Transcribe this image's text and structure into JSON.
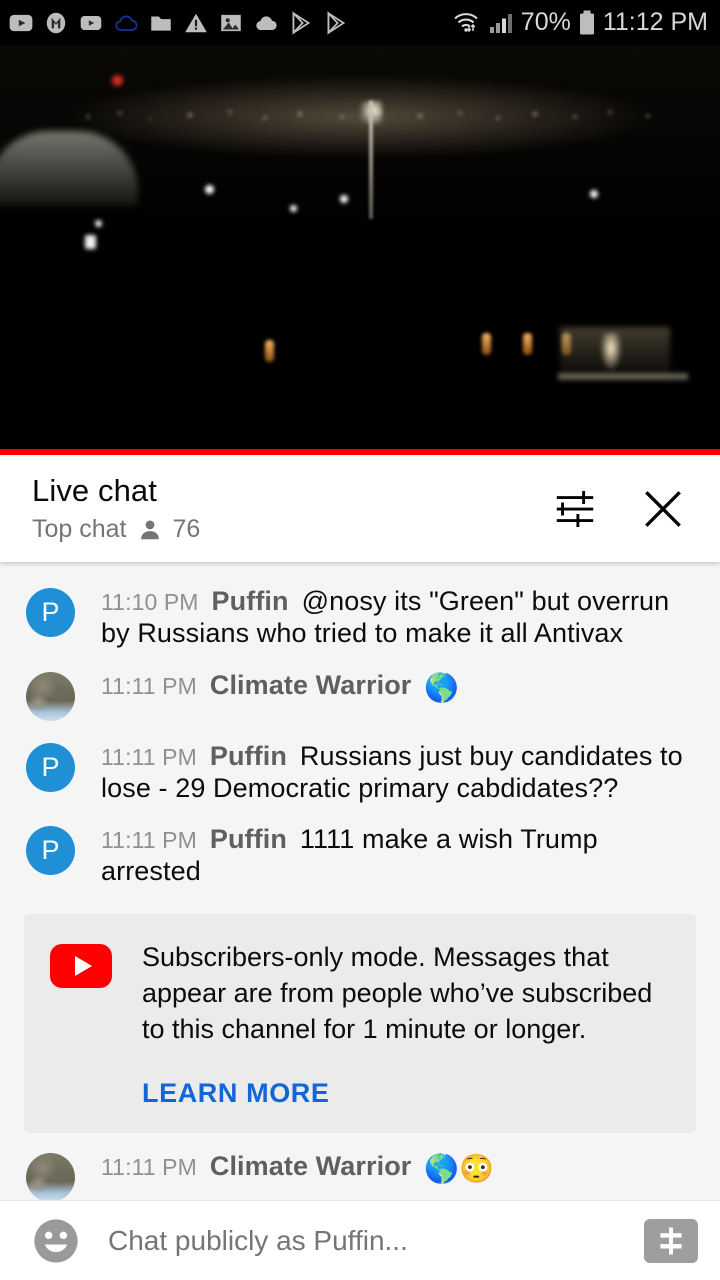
{
  "status_bar": {
    "icons": [
      "youtube-icon",
      "m-app-icon",
      "youtube-icon-2",
      "cloud-outline-icon",
      "folder-icon",
      "warning-triangle-icon",
      "image-icon",
      "cloud-filled-icon",
      "play-store-icon",
      "play-store-icon-2"
    ],
    "wifi": "wifi-icon",
    "signal": "cell-signal-icon",
    "battery_percent": "70%",
    "battery": "battery-icon",
    "time": "11:12 PM"
  },
  "video": {
    "name": "night-cityscape-live-stream",
    "progress_color": "#ff0000"
  },
  "chat_header": {
    "title": "Live chat",
    "mode": "Top chat",
    "viewer_count": "76",
    "settings_icon": "tune-sliders-icon",
    "close_icon": "close-icon"
  },
  "messages": [
    {
      "time": "11:10 PM",
      "author": "Puffin",
      "text": "@nosy its \"Green\" but overrun by Russians who tried to make it all Antivax",
      "avatar_type": "initial",
      "avatar_initial": "P",
      "avatar_color": "#1f8fd6"
    },
    {
      "time": "11:11 PM",
      "author": "Climate Warrior",
      "text": "🌎",
      "avatar_type": "photo",
      "avatar_initial": "",
      "avatar_color": "#7e7a68"
    },
    {
      "time": "11:11 PM",
      "author": "Puffin",
      "text": "Russians just buy candidates to lose - 29 Democratic primary cabdidates??",
      "avatar_type": "initial",
      "avatar_initial": "P",
      "avatar_color": "#1f8fd6"
    },
    {
      "time": "11:11 PM",
      "author": "Puffin",
      "text": "1111 make a wish Trump arrested",
      "avatar_type": "initial",
      "avatar_initial": "P",
      "avatar_color": "#1f8fd6"
    }
  ],
  "notice": {
    "icon": "youtube-logo-icon",
    "text": "Subscribers-only mode. Messages that appear are from people who’ve subscribed to this channel for 1 minute or longer.",
    "link_label": "LEARN MORE",
    "link_color": "#1266d8"
  },
  "last_message": {
    "time": "11:11 PM",
    "author": "Climate Warrior",
    "text": "🌎😳",
    "avatar_type": "photo"
  },
  "input_bar": {
    "emoji_icon": "emoji-face-icon",
    "placeholder": "Chat publicly as Puffin...",
    "superchat_icon": "dollar-sign-icon"
  }
}
